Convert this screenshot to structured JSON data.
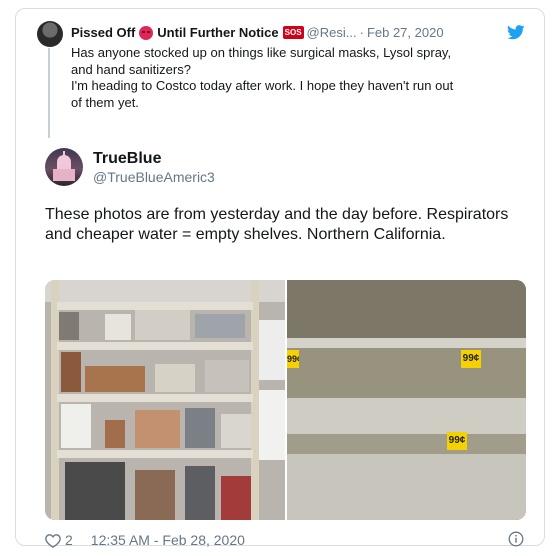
{
  "quoted_tweet": {
    "display_name_part1": "Pissed Off",
    "display_name_part2": "Until Further Notice",
    "sos_badge": "SOS",
    "handle": "@Resi...",
    "separator": "·",
    "date": "Feb 27, 2020",
    "text_lines": [
      "Has anyone stocked up on things like surgical masks, Lysol spray,",
      "and hand sanitizers?",
      "I'm heading to Costco today after work. I hope they haven't run out",
      "of them yet."
    ]
  },
  "tweet": {
    "display_name": "TrueBlue",
    "handle": "@TrueBlueAmeric3",
    "text": "These photos are from yesterday and the day before. Respirators and cheaper water = empty shelves.  Northern California."
  },
  "photos": {
    "right": {
      "price_tags": [
        "99¢",
        "99¢",
        "99¢"
      ]
    }
  },
  "footer": {
    "likes": "2",
    "timestamp": "12:35 AM - Feb 28, 2020"
  },
  "icons": {
    "brand": "twitter-bird-icon",
    "like": "heart-icon",
    "info": "info-icon",
    "brand_color": "#1da1f2"
  }
}
